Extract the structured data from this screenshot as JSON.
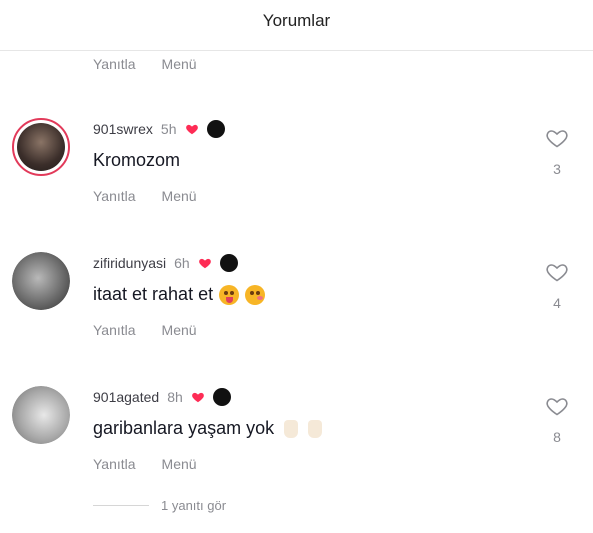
{
  "header": {
    "title": "Yorumlar"
  },
  "partial": {
    "reply": "Yanıtla",
    "menu": "Menü"
  },
  "comments": [
    {
      "user": "901swrex",
      "time": "5h",
      "text": "Kromozom",
      "likes": "3",
      "reply": "Yanıtla",
      "menu": "Menü"
    },
    {
      "user": "zifiridunyasi",
      "time": "6h",
      "text": "itaat et rahat et",
      "likes": "4",
      "reply": "Yanıtla",
      "menu": "Menü"
    },
    {
      "user": "901agated",
      "time": "8h",
      "text": "garibanlara yaşam yok",
      "likes": "8",
      "reply": "Yanıtla",
      "menu": "Menü"
    }
  ],
  "view_replies": "1 yanıtı gör",
  "icons": {
    "like": "heart-outline-icon",
    "badge": "heart-icon"
  },
  "colors": {
    "accent": "#fe2c55",
    "muted": "#8a8b91"
  }
}
